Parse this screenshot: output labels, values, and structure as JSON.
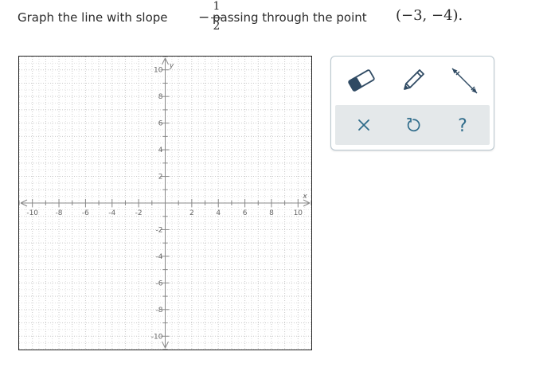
{
  "question": {
    "before_fraction": "Graph the line with slope",
    "minus_sign": "−",
    "numerator": "1",
    "denominator": "2",
    "after_fraction": "passing through the point",
    "point": "(−3, −4)."
  },
  "graph": {
    "x_axis_label": "x",
    "y_axis_label": "y",
    "x_range": [
      -11,
      11
    ],
    "y_range": [
      -11,
      11
    ],
    "x_tick_labels": [
      "-10",
      "-8",
      "-6",
      "-4",
      "-2",
      "2",
      "4",
      "6",
      "8",
      "10"
    ],
    "y_tick_labels": [
      "10",
      "8",
      "6",
      "4",
      "2",
      "-2",
      "-4",
      "-6",
      "-8",
      "-10"
    ],
    "grid": "dotted",
    "minor_step": 0.5
  },
  "toolbox": {
    "tools": [
      "eraser-icon",
      "pencil-icon",
      "line-tool-icon"
    ],
    "actions": [
      "close-icon",
      "undo-icon",
      "help-icon"
    ],
    "help_label": "?",
    "tool_color": "#2f4a63",
    "action_color": "#2e6b8a"
  }
}
